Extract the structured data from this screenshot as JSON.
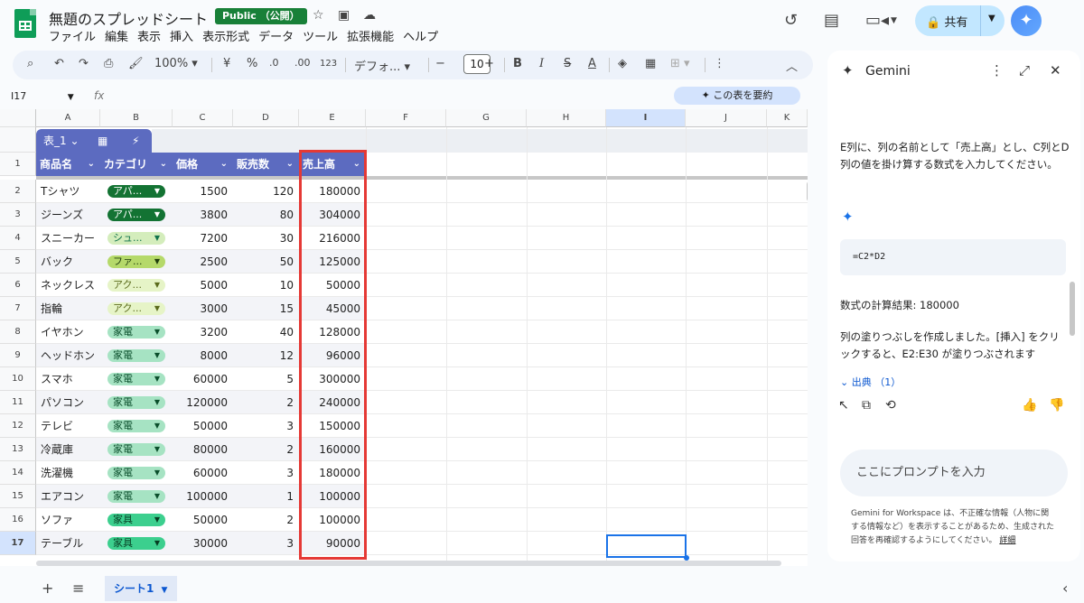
{
  "header": {
    "doc_title": "無題のスプレッドシート",
    "public_badge": "Public （公開）",
    "share_label": "共有",
    "menu": [
      "ファイル",
      "編集",
      "表示",
      "挿入",
      "表示形式",
      "データ",
      "ツール",
      "拡張機能",
      "ヘルプ"
    ]
  },
  "toolbar": {
    "zoom": "100%",
    "currency": "¥",
    "percent": "%",
    "dec_decrease": ".0",
    "dec_increase": ".00",
    "number_format": "123",
    "font": "デフォ...",
    "font_size": "10",
    "bold": "B",
    "italic": "I",
    "strike": "S",
    "text_color": "A"
  },
  "formula_bar": {
    "name_box": "I17",
    "summarize_label": "この表を要約"
  },
  "grid": {
    "columns": [
      "A",
      "B",
      "C",
      "D",
      "E",
      "F",
      "G",
      "H",
      "I",
      "J",
      "K"
    ],
    "selected_column": "I",
    "selected_row": "17",
    "table_name": "表_1",
    "headers": [
      "商品名",
      "カテゴリ",
      "価格",
      "販売数",
      "売上高"
    ],
    "rows": [
      {
        "n": "2",
        "name": "Tシャツ",
        "cat": "アパ...",
        "price": "1500",
        "qty": "120",
        "sales": "180000",
        "cat_color": "#137333",
        "cat_text": "#ffffff"
      },
      {
        "n": "3",
        "name": "ジーンズ",
        "cat": "アパ...",
        "price": "3800",
        "qty": "80",
        "sales": "304000",
        "cat_color": "#137333",
        "cat_text": "#ffffff"
      },
      {
        "n": "4",
        "name": "スニーカー",
        "cat": "シュ...",
        "price": "7200",
        "qty": "30",
        "sales": "216000",
        "cat_color": "#d4edbc",
        "cat_text": "#11734b"
      },
      {
        "n": "5",
        "name": "バック",
        "cat": "ファ...",
        "price": "2500",
        "qty": "50",
        "sales": "125000",
        "cat_color": "#b5d96a",
        "cat_text": "#1f3d0c"
      },
      {
        "n": "6",
        "name": "ネックレス",
        "cat": "アク...",
        "price": "5000",
        "qty": "10",
        "sales": "50000",
        "cat_color": "#e6f4c7",
        "cat_text": "#5b6b1c"
      },
      {
        "n": "7",
        "name": "指輪",
        "cat": "アク...",
        "price": "3000",
        "qty": "15",
        "sales": "45000",
        "cat_color": "#e6f4c7",
        "cat_text": "#5b6b1c"
      },
      {
        "n": "8",
        "name": "イヤホン",
        "cat": "家電",
        "price": "3200",
        "qty": "40",
        "sales": "128000",
        "cat_color": "#a6e3c3",
        "cat_text": "#0b4f2c"
      },
      {
        "n": "9",
        "name": "ヘッドホン",
        "cat": "家電",
        "price": "8000",
        "qty": "12",
        "sales": "96000",
        "cat_color": "#a6e3c3",
        "cat_text": "#0b4f2c"
      },
      {
        "n": "10",
        "name": "スマホ",
        "cat": "家電",
        "price": "60000",
        "qty": "5",
        "sales": "300000",
        "cat_color": "#a6e3c3",
        "cat_text": "#0b4f2c"
      },
      {
        "n": "11",
        "name": "パソコン",
        "cat": "家電",
        "price": "120000",
        "qty": "2",
        "sales": "240000",
        "cat_color": "#a6e3c3",
        "cat_text": "#0b4f2c"
      },
      {
        "n": "12",
        "name": "テレビ",
        "cat": "家電",
        "price": "50000",
        "qty": "3",
        "sales": "150000",
        "cat_color": "#a6e3c3",
        "cat_text": "#0b4f2c"
      },
      {
        "n": "13",
        "name": "冷蔵庫",
        "cat": "家電",
        "price": "80000",
        "qty": "2",
        "sales": "160000",
        "cat_color": "#a6e3c3",
        "cat_text": "#0b4f2c"
      },
      {
        "n": "14",
        "name": "洗濯機",
        "cat": "家電",
        "price": "60000",
        "qty": "3",
        "sales": "180000",
        "cat_color": "#a6e3c3",
        "cat_text": "#0b4f2c"
      },
      {
        "n": "15",
        "name": "エアコン",
        "cat": "家電",
        "price": "100000",
        "qty": "1",
        "sales": "100000",
        "cat_color": "#a6e3c3",
        "cat_text": "#0b4f2c"
      },
      {
        "n": "16",
        "name": "ソファ",
        "cat": "家具",
        "price": "50000",
        "qty": "2",
        "sales": "100000",
        "cat_color": "#3ccf8e",
        "cat_text": "#063d22"
      },
      {
        "n": "17",
        "name": "テーブル",
        "cat": "家具",
        "price": "30000",
        "qty": "3",
        "sales": "90000",
        "cat_color": "#3ccf8e",
        "cat_text": "#063d22"
      }
    ]
  },
  "sheet_tab": "シート1",
  "gemini": {
    "title": "Gemini",
    "prompt_text": "E列に、列の名前として「売上高」とし、C列とD列の値を掛け算する数式を入力してください。",
    "formula": "=C2*D2",
    "result": "数式の計算結果: 180000",
    "fill_note": "列の塗りつぶしを作成しました。[挿入] をクリックすると、E2:E30 が塗りつぶされます",
    "sources": "出典 （1）",
    "input_placeholder": "ここにプロンプトを入力",
    "disclaimer": "Gemini for Workspace は、不正確な情報（人物に関する情報など）を表示することがあるため、生成された回答を再確認するようにしてください。",
    "details_link": "詳細"
  }
}
